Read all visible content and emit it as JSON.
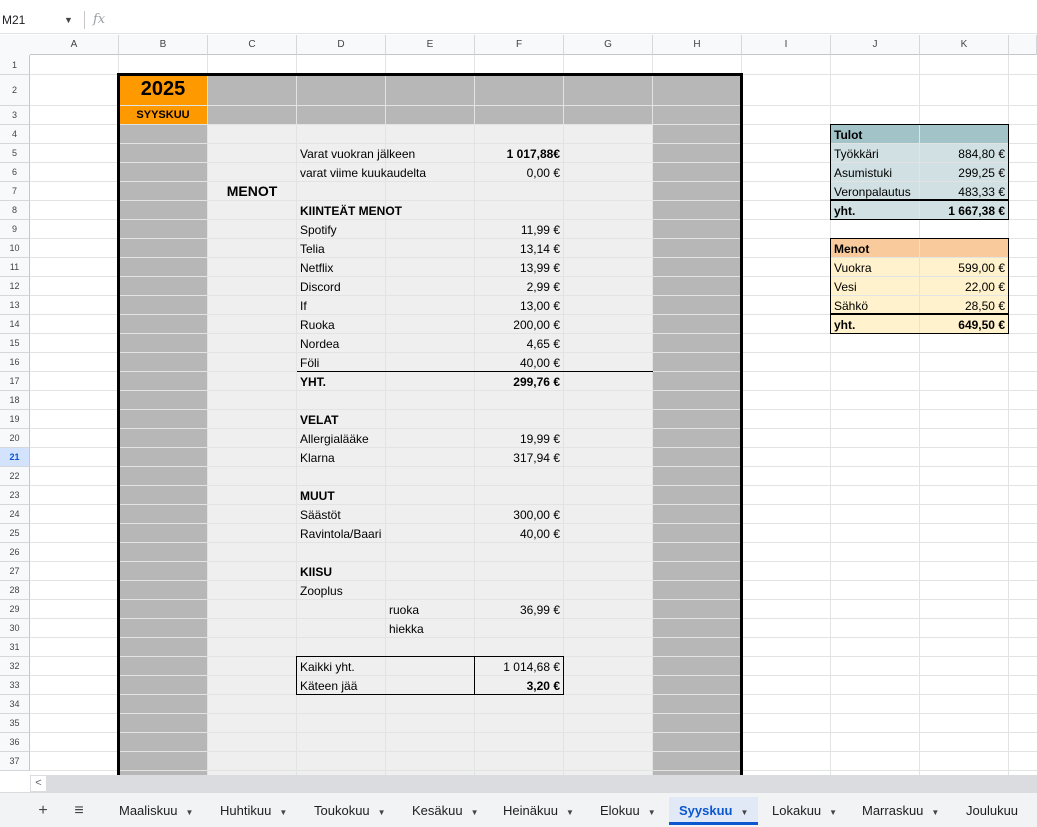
{
  "namebox": {
    "cell": "M21"
  },
  "formula_bar": {
    "fx": "fx"
  },
  "columns": [
    "A",
    "B",
    "C",
    "D",
    "E",
    "F",
    "G",
    "H",
    "I",
    "J",
    "K"
  ],
  "rows": [
    "1",
    "2",
    "3",
    "4",
    "5",
    "6",
    "7",
    "8",
    "9",
    "10",
    "11",
    "12",
    "13",
    "14",
    "15",
    "16",
    "17",
    "18",
    "19",
    "20",
    "21",
    "22",
    "23",
    "24",
    "25",
    "26",
    "27",
    "28",
    "29",
    "30",
    "31",
    "32",
    "33",
    "34",
    "35",
    "36",
    "37"
  ],
  "selected_row": "21",
  "budget": {
    "year": "2025",
    "month": "SYYSKUU",
    "varat_label": "Varat vuokran jälkeen",
    "varat_value": "1 017,88€",
    "prev_label": "varat viime kuukaudelta",
    "prev_value": "0,00 €",
    "menot_title": "MENOT",
    "fixed_title": "KIINTEÄT MENOT",
    "fixed_items": [
      {
        "label": "Spotify",
        "value": "11,99 €"
      },
      {
        "label": "Telia",
        "value": "13,14 €"
      },
      {
        "label": "Netflix",
        "value": "13,99 €"
      },
      {
        "label": "Discord",
        "value": "2,99 €"
      },
      {
        "label": "If",
        "value": "13,00 €"
      },
      {
        "label": "Ruoka",
        "value": "200,00 €"
      },
      {
        "label": "Nordea",
        "value": "4,65 €"
      },
      {
        "label": "Föli",
        "value": "40,00 €"
      }
    ],
    "fixed_total_label": "YHT.",
    "fixed_total_value": "299,76 €",
    "velat_title": "VELAT",
    "velat_items": [
      {
        "label": "Allergialääke",
        "value": "19,99 €"
      },
      {
        "label": "Klarna",
        "value": "317,94 €"
      }
    ],
    "muut_title": "MUUT",
    "muut_items": [
      {
        "label": "Säästöt",
        "value": "300,00 €"
      },
      {
        "label": "Ravintola/Baari",
        "value": "40,00 €"
      }
    ],
    "kiisu_title": "KIISU",
    "zooplus_label": "Zooplus",
    "kiisu_items": [
      {
        "label": "ruoka",
        "value": "36,99 €"
      },
      {
        "label": "hiekka",
        "value": ""
      }
    ],
    "all_total_label": "Kaikki yht.",
    "all_total_value": "1 014,68 €",
    "left_label": "Käteen jää",
    "left_value": "3,20 €"
  },
  "tulot": {
    "title": "Tulot",
    "items": [
      {
        "label": "Työkkäri",
        "value": "884,80 €"
      },
      {
        "label": "Asumistuki",
        "value": "299,25 €"
      },
      {
        "label": "Veronpalautus",
        "value": "483,33 €"
      }
    ],
    "total_label": "yht.",
    "total_value": "1 667,38 €"
  },
  "menot_box": {
    "title": "Menot",
    "items": [
      {
        "label": "Vuokra",
        "value": "599,00 €"
      },
      {
        "label": "Vesi",
        "value": "22,00 €"
      },
      {
        "label": "Sähkö",
        "value": "28,50 €"
      }
    ],
    "total_label": "yht.",
    "total_value": "649,50 €"
  },
  "sheet_tabs": [
    "Maaliskuu",
    "Huhtikuu",
    "Toukokuu",
    "Kesäkuu",
    "Heinäkuu",
    "Elokuu",
    "Syyskuu",
    "Lokakuu",
    "Marraskuu",
    "Joulukuu"
  ],
  "active_tab": "Syyskuu",
  "colors": {
    "orange": "#ff9900",
    "dark_gray": "#b7b7b7",
    "light_gray": "#efefef",
    "tulot_header": "#a2c4c9",
    "tulot_body": "#d0e0e3",
    "menot_header": "#f9cb9c",
    "menot_body": "#fff2cc"
  }
}
